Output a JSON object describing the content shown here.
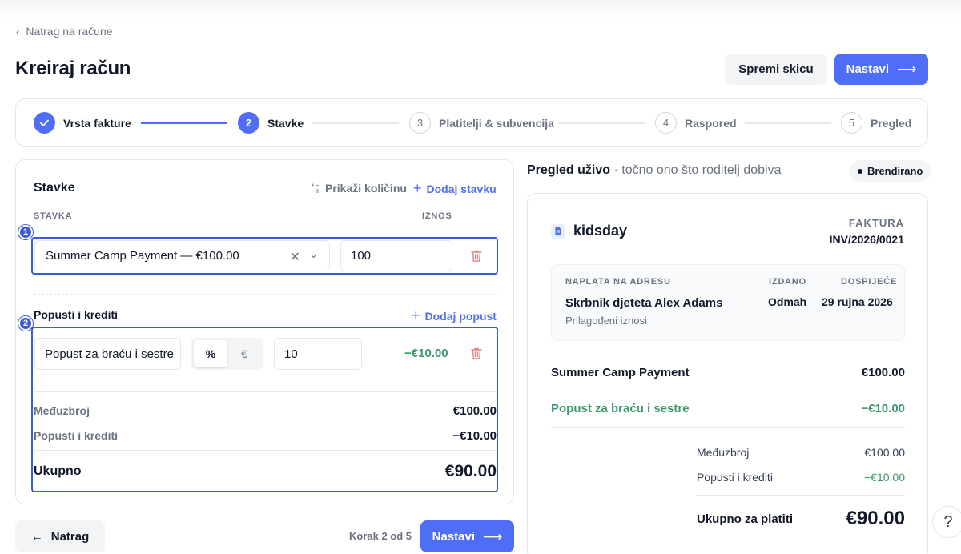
{
  "nav": {
    "back_label": "Natrag na račune"
  },
  "header": {
    "title": "Kreiraj račun",
    "save_draft_label": "Spremi skicu",
    "next_label": "Nastavi"
  },
  "steps": [
    {
      "num": "",
      "label": "Vrsta fakture",
      "state": "done"
    },
    {
      "num": "2",
      "label": "Stavke",
      "state": "active"
    },
    {
      "num": "3",
      "label": "Platitelji & subvencija",
      "state": "todo"
    },
    {
      "num": "4",
      "label": "Raspored",
      "state": "todo"
    },
    {
      "num": "5",
      "label": "Pregled",
      "state": "todo"
    }
  ],
  "items_card": {
    "title": "Stavke",
    "show_qty_label": "Prikaži količinu",
    "add_item_label": "Dodaj stavku",
    "col_item": "STAVKA",
    "col_amount": "IZNOS",
    "row_badge": "1",
    "item_select_value": "Summer Camp Payment — €100.00",
    "item_amount_value": "100",
    "discounts_title": "Popusti i krediti",
    "add_discount_label": "Dodaj popust",
    "discount_badge": "2",
    "discount_name_value": "Popust za braću i sestre",
    "discount_type_percent": "%",
    "discount_type_euro": "€",
    "discount_value": "10",
    "discount_amount": "−€10.00",
    "subtotal_label": "Međuzbroj",
    "subtotal_value": "€100.00",
    "discounts_label": "Popusti i krediti",
    "discounts_value": "−€10.00",
    "total_label": "Ukupno",
    "total_value": "€90.00"
  },
  "footer": {
    "back_label": "Natrag",
    "step_count": "Korak 2 od 5",
    "next_label": "Nastavi"
  },
  "preview": {
    "title": "Pregled uživo",
    "subtitle": " · točno ono što roditelj dobiva",
    "badge": "Brendirano",
    "brand_name": "kidsday",
    "invoice_label": "FAKTURA",
    "invoice_number": "INV/2026/0021",
    "bill_to_label": "NAPLATA NA ADRESU",
    "bill_to_name": "Skrbnik djeteta Alex Adams",
    "bill_to_note": "Prilagođeni iznosi",
    "issued_label": "IZDANO",
    "issued_value": "Odmah",
    "due_label": "DOSPIJEĆE",
    "due_value": "29 rujna 2026",
    "line_item_name": "Summer Camp Payment",
    "line_item_amount": "€100.00",
    "discount_name": "Popust za braću i sestre",
    "discount_amount": "−€10.00",
    "subtotal_label": "Međuzbroj",
    "subtotal_value": "€100.00",
    "discounts_label": "Popusti i krediti",
    "discounts_value": "−€10.00",
    "total_label": "Ukupno za platiti",
    "total_value": "€90.00"
  },
  "help_label": "?"
}
